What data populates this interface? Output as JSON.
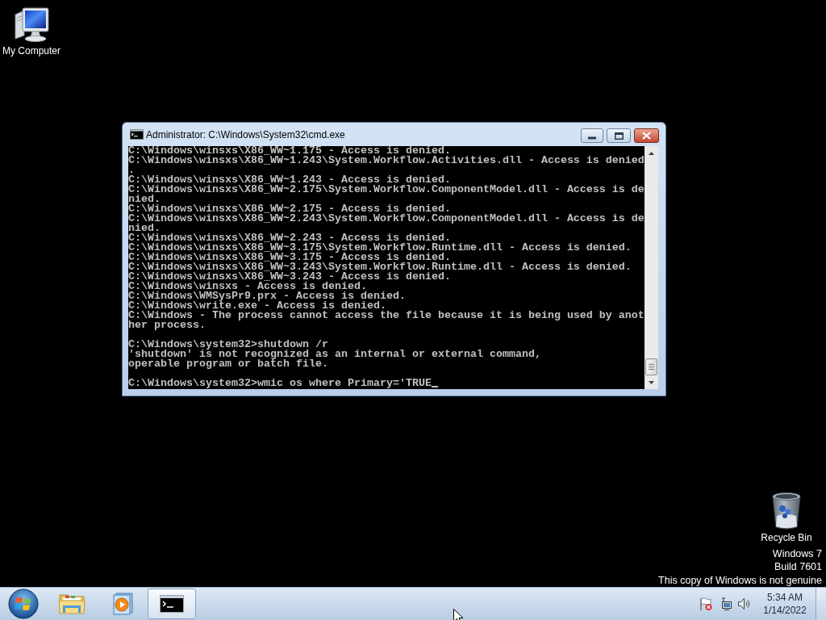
{
  "desktop_icons": [
    {
      "kind": "computer",
      "label": "My Computer"
    },
    {
      "kind": "recycle-bin",
      "label": "Recycle Bin"
    }
  ],
  "window": {
    "title": "Administrator: C:\\Windows\\System32\\cmd.exe",
    "console_blocks": [
      [
        "C:\\Windows\\winsxs\\X86_WW~1.175 - Access is denied.",
        "C:\\Windows\\winsxs\\X86_WW~1.243\\System.Workflow.Activities.dll - Access is denied",
        ".",
        "C:\\Windows\\winsxs\\X86_WW~1.243 - Access is denied.",
        "C:\\Windows\\winsxs\\X86_WW~2.175\\System.Workflow.ComponentModel.dll - Access is de",
        "nied.",
        "C:\\Windows\\winsxs\\X86_WW~2.175 - Access is denied.",
        "C:\\Windows\\winsxs\\X86_WW~2.243\\System.Workflow.ComponentModel.dll - Access is de",
        "nied.",
        "C:\\Windows\\winsxs\\X86_WW~2.243 - Access is denied.",
        "C:\\Windows\\winsxs\\X86_WW~3.175\\System.Workflow.Runtime.dll - Access is denied.",
        "C:\\Windows\\winsxs\\X86_WW~3.175 - Access is denied.",
        "C:\\Windows\\winsxs\\X86_WW~3.243\\System.Workflow.Runtime.dll - Access is denied.",
        "C:\\Windows\\winsxs\\X86_WW~3.243 - Access is denied.",
        "C:\\Windows\\winsxs - Access is denied.",
        "C:\\Windows\\WMSysPr9.prx - Access is denied.",
        "C:\\Windows\\write.exe - Access is denied.",
        "C:\\Windows - The process cannot access the file because it is being used by anot",
        "her process."
      ],
      [
        "C:\\Windows\\system32>shutdown /r",
        "'shutdown' is not recognized as an internal or external command,",
        "operable program or batch file."
      ],
      [
        "C:\\Windows\\system32>wmic os where Primary='TRUE"
      ]
    ]
  },
  "genuine_notice": [
    "Windows 7",
    "Build 7601",
    "This copy of Windows is not genuine"
  ],
  "taskbar": {
    "items": [
      {
        "kind": "explorer",
        "active": false
      },
      {
        "kind": "media-player",
        "active": false
      },
      {
        "kind": "console",
        "active": true
      }
    ],
    "clock": {
      "time": "5:34 AM",
      "date": "1/14/2022"
    }
  }
}
